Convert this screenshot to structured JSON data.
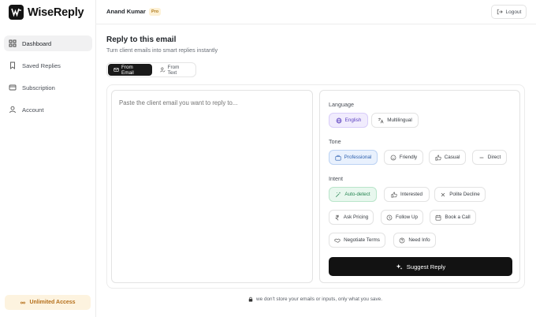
{
  "brand": {
    "name": "WiseReply"
  },
  "sidebar": {
    "items": [
      {
        "label": "Dashboard",
        "icon": "grid-icon"
      },
      {
        "label": "Saved Replies",
        "icon": "bookmark-icon"
      },
      {
        "label": "Subscription",
        "icon": "credit-card-icon"
      },
      {
        "label": "Account",
        "icon": "user-icon"
      }
    ],
    "plan_label": "Unlimited Access"
  },
  "header": {
    "user_name": "Anand Kumar",
    "badge": "Pro",
    "logout_label": "Logout"
  },
  "main": {
    "title": "Reply to this email",
    "subtitle": "Turn client emails into smart replies instantly",
    "tabs": [
      {
        "label": "From Email"
      },
      {
        "label": "From Text"
      }
    ],
    "email_placeholder": "Paste the client email you want to reply to...",
    "language": {
      "label": "Language",
      "options": [
        "English",
        "Multilingual"
      ],
      "selected": "English"
    },
    "tone": {
      "label": "Tone",
      "options": [
        "Professional",
        "Friendly",
        "Casual",
        "Direct"
      ],
      "selected": "Professional"
    },
    "intent": {
      "label": "Intent",
      "options": [
        "Auto-detect",
        "Interested",
        "Polite Decline",
        "Ask Pricing",
        "Follow Up",
        "Book a Call",
        "Negotiate Terms",
        "Need Info"
      ],
      "selected": "Auto-detect"
    },
    "suggest_label": "Suggest Reply",
    "privacy_note": "we don't store your emails or inputs, only what you save."
  },
  "colors": {
    "accent_dark": "#121212",
    "language_selected": "#f1ecfd",
    "tone_selected": "#e9f1fd",
    "intent_selected": "#e8f7ee",
    "plan_badge": "#fdf3df"
  }
}
